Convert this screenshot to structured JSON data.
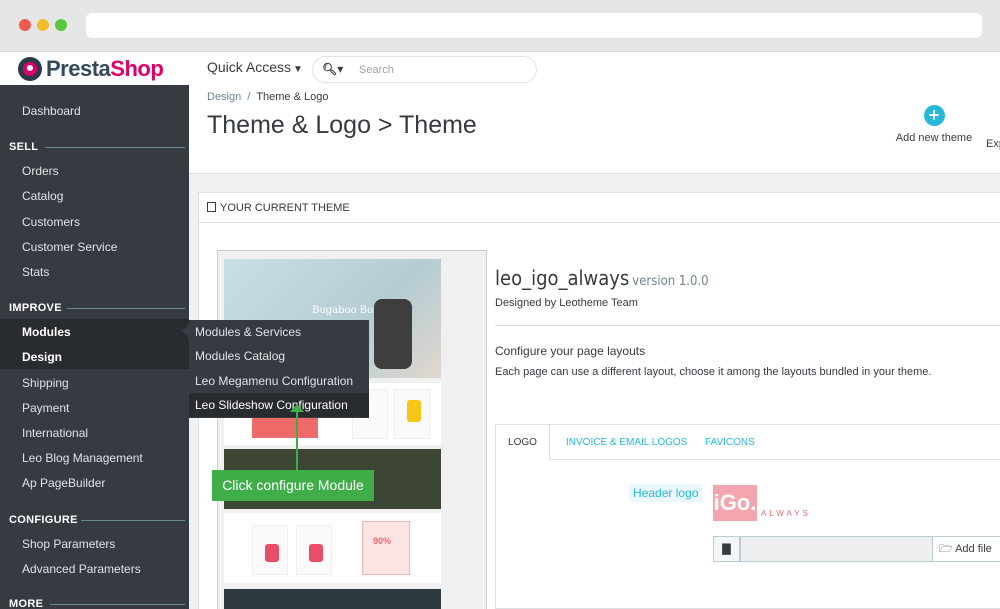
{
  "app": {
    "brand_presta": "Presta",
    "brand_shop": "Shop"
  },
  "header": {
    "quick_access": "Quick Access",
    "search_placeholder": "Search"
  },
  "sidebar": {
    "dashboard": "Dashboard",
    "sections": [
      {
        "title": "SELL",
        "items": [
          "Orders",
          "Catalog",
          "Customers",
          "Customer Service",
          "Stats"
        ]
      },
      {
        "title": "IMPROVE",
        "items": [
          "Modules",
          "Design",
          "Shipping",
          "Payment",
          "International",
          "Leo Blog Management",
          "Ap PageBuilder"
        ]
      },
      {
        "title": "CONFIGURE",
        "items": [
          "Shop Parameters",
          "Advanced Parameters"
        ]
      },
      {
        "title": "MORE",
        "items": []
      }
    ]
  },
  "submenu": {
    "items": [
      "Modules & Services",
      "Modules Catalog",
      "Leo Megamenu Configuration",
      "Leo Slideshow Configuration"
    ]
  },
  "breadcrumb": {
    "parent": "Design",
    "separator": "/",
    "current": "Theme & Logo"
  },
  "page": {
    "title": "Theme & Logo > Theme",
    "add_new_theme": "Add new theme",
    "export": "Exp"
  },
  "panel": {
    "heading": "YOUR CURRENT THEME"
  },
  "preview": {
    "hero_text": "Bugaboo Boxer",
    "sale_badge": "90%"
  },
  "annotation": {
    "label": "Click configure Module"
  },
  "theme": {
    "name": "leo_igo_always",
    "version": "version 1.0.0",
    "designed_by": "Designed by Leotheme Team",
    "layout_title": "Configure your page layouts",
    "layout_desc": "Each page can use a different layout, choose it among the layouts bundled in your theme."
  },
  "tabs": [
    "LOGO",
    "INVOICE & EMAIL LOGOS",
    "FAVICONS"
  ],
  "logo_form": {
    "header_logo_label": "Header logo",
    "logo_main": "iGo.",
    "logo_sub": "ALWAYS",
    "add_file": "Add file"
  },
  "colors": {
    "brand_pink": "#df0067",
    "accent_blue": "#25b9d7",
    "sidebar_bg": "#363a41",
    "annotation_green": "#3fae49"
  }
}
